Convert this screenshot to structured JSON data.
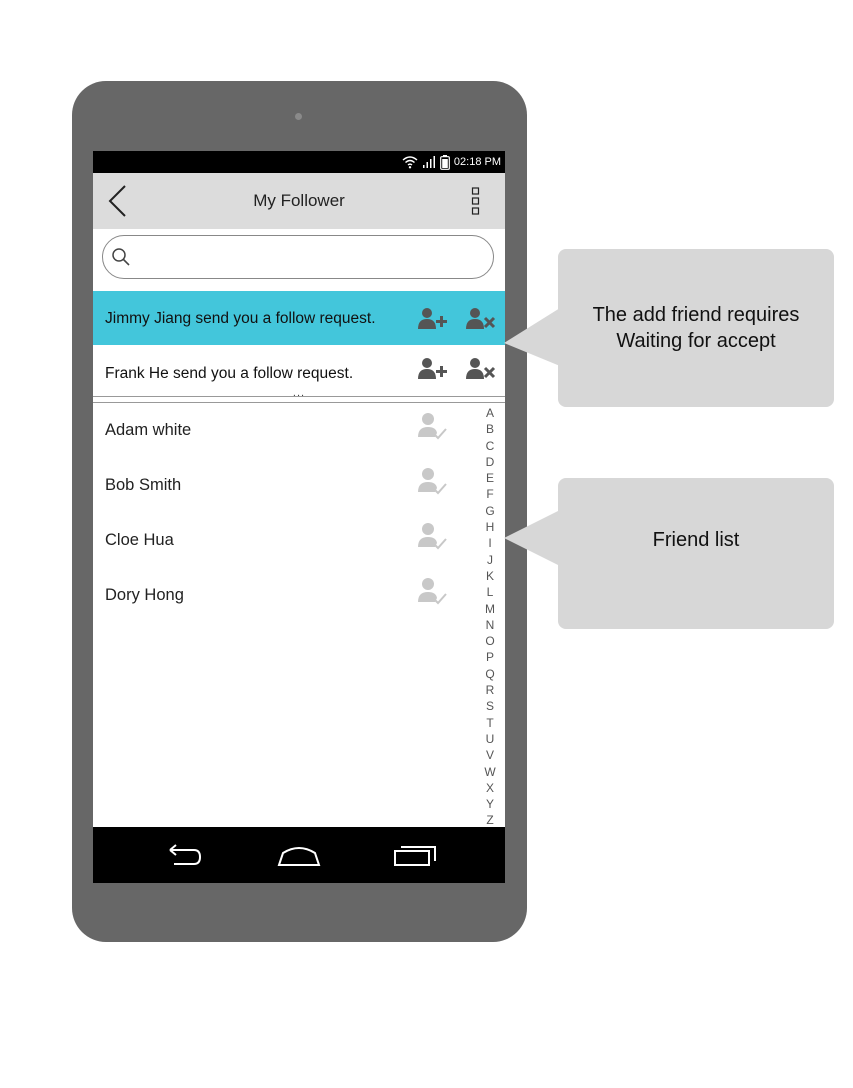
{
  "status_bar": {
    "time": "02:18 PM"
  },
  "app_bar": {
    "title": "My Follower"
  },
  "search": {
    "value": "",
    "placeholder": ""
  },
  "requests": [
    {
      "text": "Jimmy Jiang send you a follow request.",
      "highlighted": true
    },
    {
      "text": "Frank He send you a follow request.",
      "highlighted": false
    }
  ],
  "more_indicator": "...",
  "friends": [
    {
      "name": "Adam white"
    },
    {
      "name": "Bob Smith"
    },
    {
      "name": "Cloe Hua"
    },
    {
      "name": "Dory Hong"
    }
  ],
  "alphabet": [
    "A",
    "B",
    "C",
    "D",
    "E",
    "F",
    "G",
    "H",
    "I",
    "J",
    "K",
    "L",
    "M",
    "N",
    "O",
    "P",
    "Q",
    "R",
    "S",
    "T",
    "U",
    "V",
    "W",
    "X",
    "Y",
    "Z"
  ],
  "callouts": {
    "requests_note": {
      "line1": "The add friend requires",
      "line2": "Waiting for accept"
    },
    "friends_note": {
      "line1": "Friend list"
    }
  },
  "icons": {
    "back": "back-arrow-icon",
    "menu": "overflow-menu-icon",
    "search": "search-icon",
    "accept": "add-user-icon",
    "reject": "remove-user-icon",
    "friend": "user-check-icon",
    "nav_back": "nav-back-icon",
    "nav_home": "nav-home-icon",
    "nav_recent": "nav-recent-apps-icon"
  },
  "colors": {
    "highlight": "#43c6db",
    "device": "#676767",
    "appbar": "#dcdcdc",
    "callout": "#d7d7d7"
  }
}
